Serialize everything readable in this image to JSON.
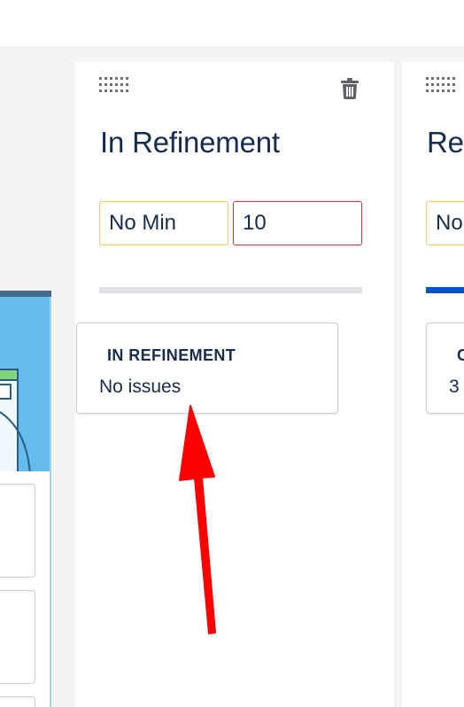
{
  "columns": [
    {
      "title": "In Refinement",
      "min_limit": "No Min",
      "max_limit": "10",
      "progress": 0.0,
      "status_card": {
        "heading": "IN REFINEMENT",
        "text": "No issues"
      }
    },
    {
      "title": "Re",
      "min_limit": "No",
      "progress": 1.0,
      "status_card": {
        "heading": "C",
        "text": "3"
      }
    }
  ],
  "icons": {
    "drag_handle": "drag-handle-icon",
    "delete": "trash-icon",
    "annotation": "red-arrow"
  },
  "colors": {
    "title_text": "#172b4d",
    "min_input_border": "#f2cc66",
    "max_input_border": "#c23b3b",
    "progress_track": "#dfe1e6",
    "progress_fill": "#0052cc",
    "annotation_arrow": "#ff0000",
    "board_background": "#f4f4f4"
  }
}
